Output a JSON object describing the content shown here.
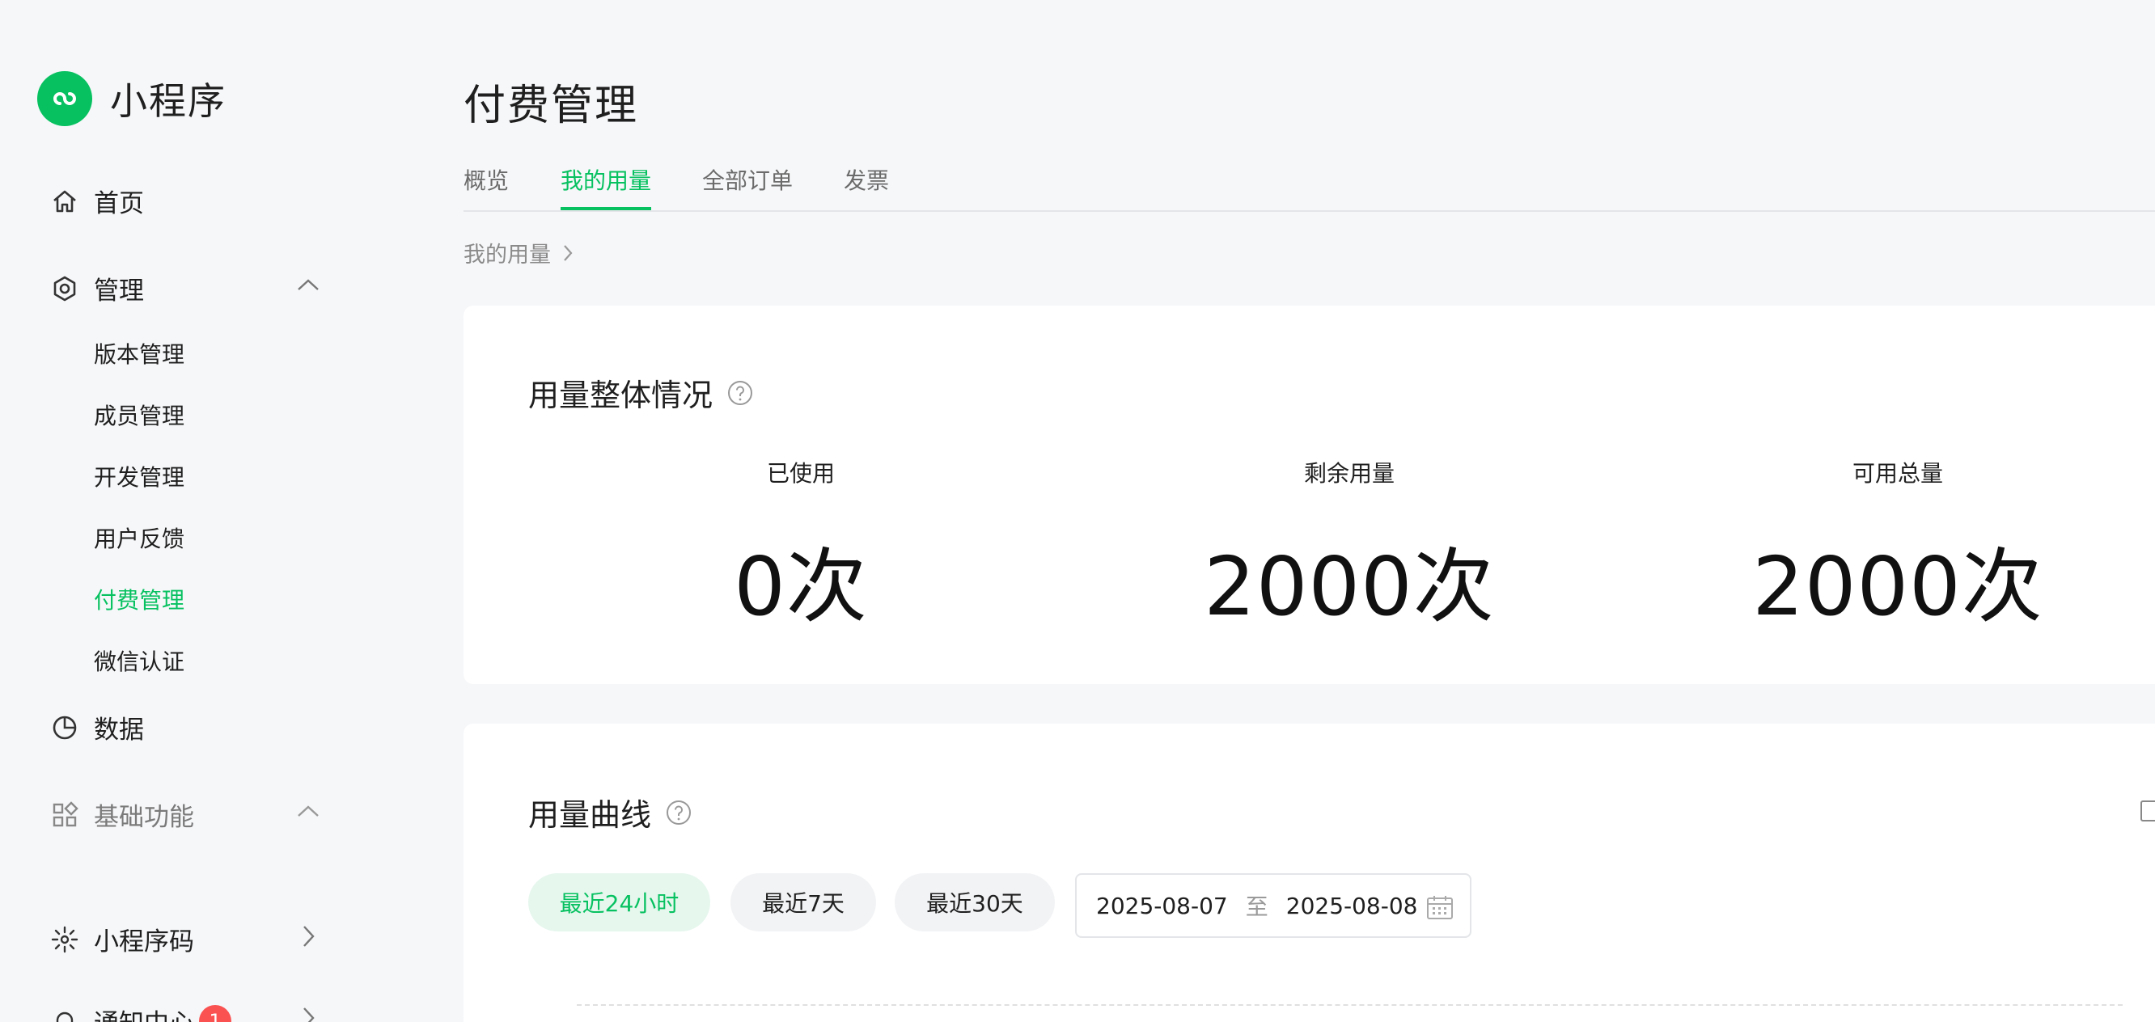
{
  "brand": {
    "name": "小程序"
  },
  "sidebar": {
    "home": "首页",
    "manage": "管理",
    "manage_items": [
      "版本管理",
      "成员管理",
      "开发管理",
      "用户反馈",
      "付费管理",
      "微信认证"
    ],
    "data": "数据",
    "basic": "基础功能",
    "qrcode": "小程序码",
    "notify": "通知中心",
    "notify_badge": "1"
  },
  "page": {
    "title": "付费管理",
    "tabs": [
      "概览",
      "我的用量",
      "全部订单",
      "发票"
    ],
    "active_tab": "我的用量",
    "breadcrumb": "我的用量"
  },
  "overview": {
    "title": "用量整体情况",
    "stats": [
      {
        "label": "已使用",
        "value": "0次"
      },
      {
        "label": "剩余用量",
        "value": "2000次"
      },
      {
        "label": "可用总量",
        "value": "2000次"
      }
    ]
  },
  "curve": {
    "title": "用量曲线",
    "ranges": [
      "最近24小时",
      "最近7天",
      "最近30天"
    ],
    "active_range": "最近24小时",
    "date_start": "2025-08-07",
    "date_sep": "至",
    "date_end": "2025-08-08"
  },
  "colors": {
    "accent": "#07c160",
    "badge": "#fa5151"
  }
}
